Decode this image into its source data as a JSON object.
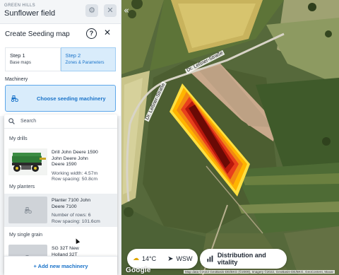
{
  "field": {
    "farm": "GREEN HILLS",
    "name": "Sunflower field"
  },
  "dialog": {
    "title": "Create Seeding map"
  },
  "steps": [
    {
      "label": "Step 1",
      "sub": "Base maps",
      "active": false
    },
    {
      "label": "Step 2",
      "sub": "Zones & Parameters",
      "active": true
    }
  ],
  "machinery": {
    "label": "Machinery",
    "choose_label": "Choose seeding machinery",
    "search_placeholder": "Search",
    "groups": [
      {
        "title": "My drills",
        "items": [
          {
            "name": "Drill John Deere 1590 John Deere John Deere 1590",
            "spec1": "Working width: 4.57m",
            "spec2": "Row spacing: 50.8cm"
          }
        ]
      },
      {
        "title": "My planters",
        "items": [
          {
            "name": "Planter 7100 John Deere 7100",
            "spec1": "Number of rows: 6",
            "spec2": "Row spacing: 101.6cm"
          }
        ]
      },
      {
        "title": "My single grain",
        "items": [
          {
            "name": "SG 32T New Holland 32T",
            "spec1": "",
            "spec2": ""
          }
        ]
      }
    ],
    "add_label": "+ Add new machinery"
  },
  "map": {
    "road_label": "Dr. Leßner-Straße",
    "google": "Google",
    "attribution": "Map data ©2022 GeoBasis-DE/BKG (©2009), Imagery ©2022, GeoBasis-DE/BKG, GeoContent, Maxar",
    "weather": {
      "temperature": "14°C",
      "wind": "WSW"
    },
    "distribution_label": "Distribution and vitality"
  },
  "colors": {
    "accent": "#1a73c9",
    "zone_high": "#6b0a05",
    "zone_mid": "#e8401c",
    "zone_low": "#ffb400",
    "zone_edge": "#ffe040"
  }
}
